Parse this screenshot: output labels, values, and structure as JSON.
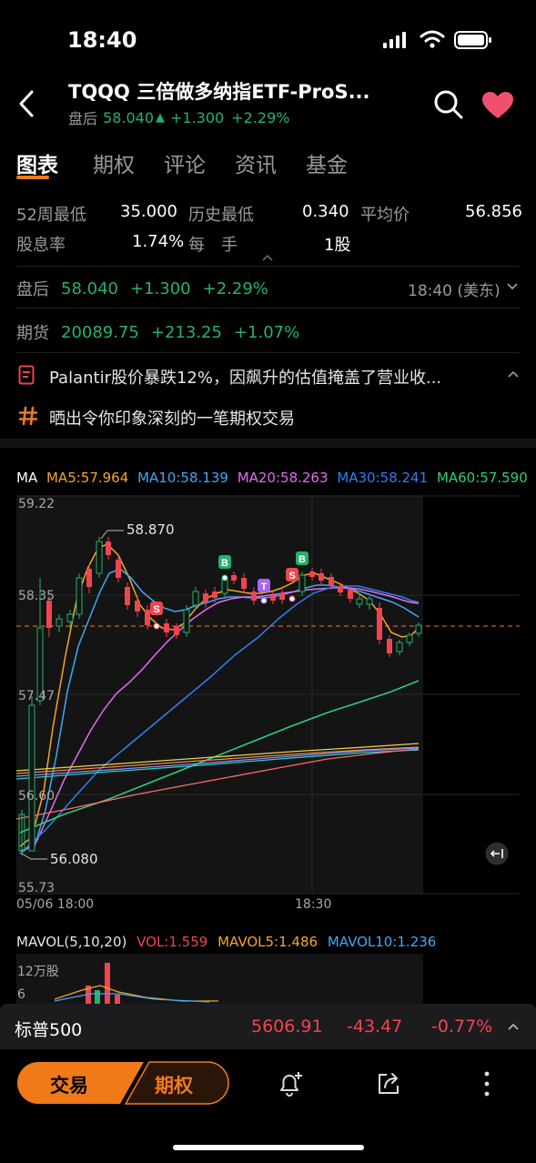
{
  "status_bar": {
    "time": "18:40"
  },
  "header": {
    "title": "TQQQ 三倍做多纳指ETF-ProS...",
    "session_label": "盘后",
    "price": "58.040",
    "change": "+1.300",
    "change_pct": "+2.29%"
  },
  "tabs": [
    "图表",
    "期权",
    "评论",
    "资讯",
    "基金"
  ],
  "stats": {
    "low52_label": "52周最低",
    "low52_value": "35.000",
    "hist_low_label": "历史最低",
    "hist_low_value": "0.340",
    "avg_label": "平均价",
    "avg_value": "56.856",
    "div_label": "股息率",
    "div_value": "1.74%",
    "lot_label": "每　手",
    "lot_value": "1股"
  },
  "afterhours": {
    "label": "盘后",
    "price": "58.040",
    "change": "+1.300",
    "change_pct": "+2.29%",
    "time": "18:40 (美东)"
  },
  "futures": {
    "label": "期货",
    "price": "20089.75",
    "change": "+213.25",
    "change_pct": "+1.07%"
  },
  "news": [
    {
      "text": "Palantir股价暴跌12%，因飙升的估值掩盖了营业收..."
    },
    {
      "text": "晒出令你印象深刻的一笔期权交易"
    }
  ],
  "ma_legend": {
    "ma": "MA",
    "ma5": "MA5:57.964",
    "ma10": "MA10:58.139",
    "ma20": "MA20:58.263",
    "ma30": "MA30:58.241",
    "ma60": "MA60:57.590"
  },
  "chart_axis": {
    "y_ticks": [
      "59.22",
      "58.35",
      "57.47",
      "56.60",
      "55.73"
    ],
    "x_ticks": [
      "05/06 18:00",
      "18:30"
    ],
    "high_label": "58.870",
    "low_label": "56.080"
  },
  "mavol_legend": {
    "title": "MAVOL(5,10,20)",
    "vol": "VOL:1.559",
    "mavol5": "MAVOL5:1.486",
    "mavol10": "MAVOL10:1.236",
    "unit": "12万股",
    "tick": "6"
  },
  "index_bar": {
    "name": "标普500",
    "value": "5606.91",
    "change": "-43.47",
    "change_pct": "-0.77%"
  },
  "bottom_bar": {
    "trade_label": "交易",
    "options_label": "期权"
  },
  "colors": {
    "up": "#23b26d",
    "down": "#f0454e",
    "accent": "#f07a1a",
    "ma5": "#f5a623",
    "ma10": "#3fa9f5",
    "ma20": "#e36df0",
    "ma30": "#2f7ff5",
    "ma60": "#2fcf7a"
  },
  "icons": {
    "back": "chevron-left-icon",
    "search": "search-icon",
    "favorite": "heart-icon",
    "news": "document-icon",
    "hashtag": "hashtag-icon",
    "alert": "bell-plus-icon",
    "share": "share-icon",
    "more": "more-vertical-icon",
    "collapse": "chevron-up-icon",
    "expand": "chevron-down-icon"
  }
}
